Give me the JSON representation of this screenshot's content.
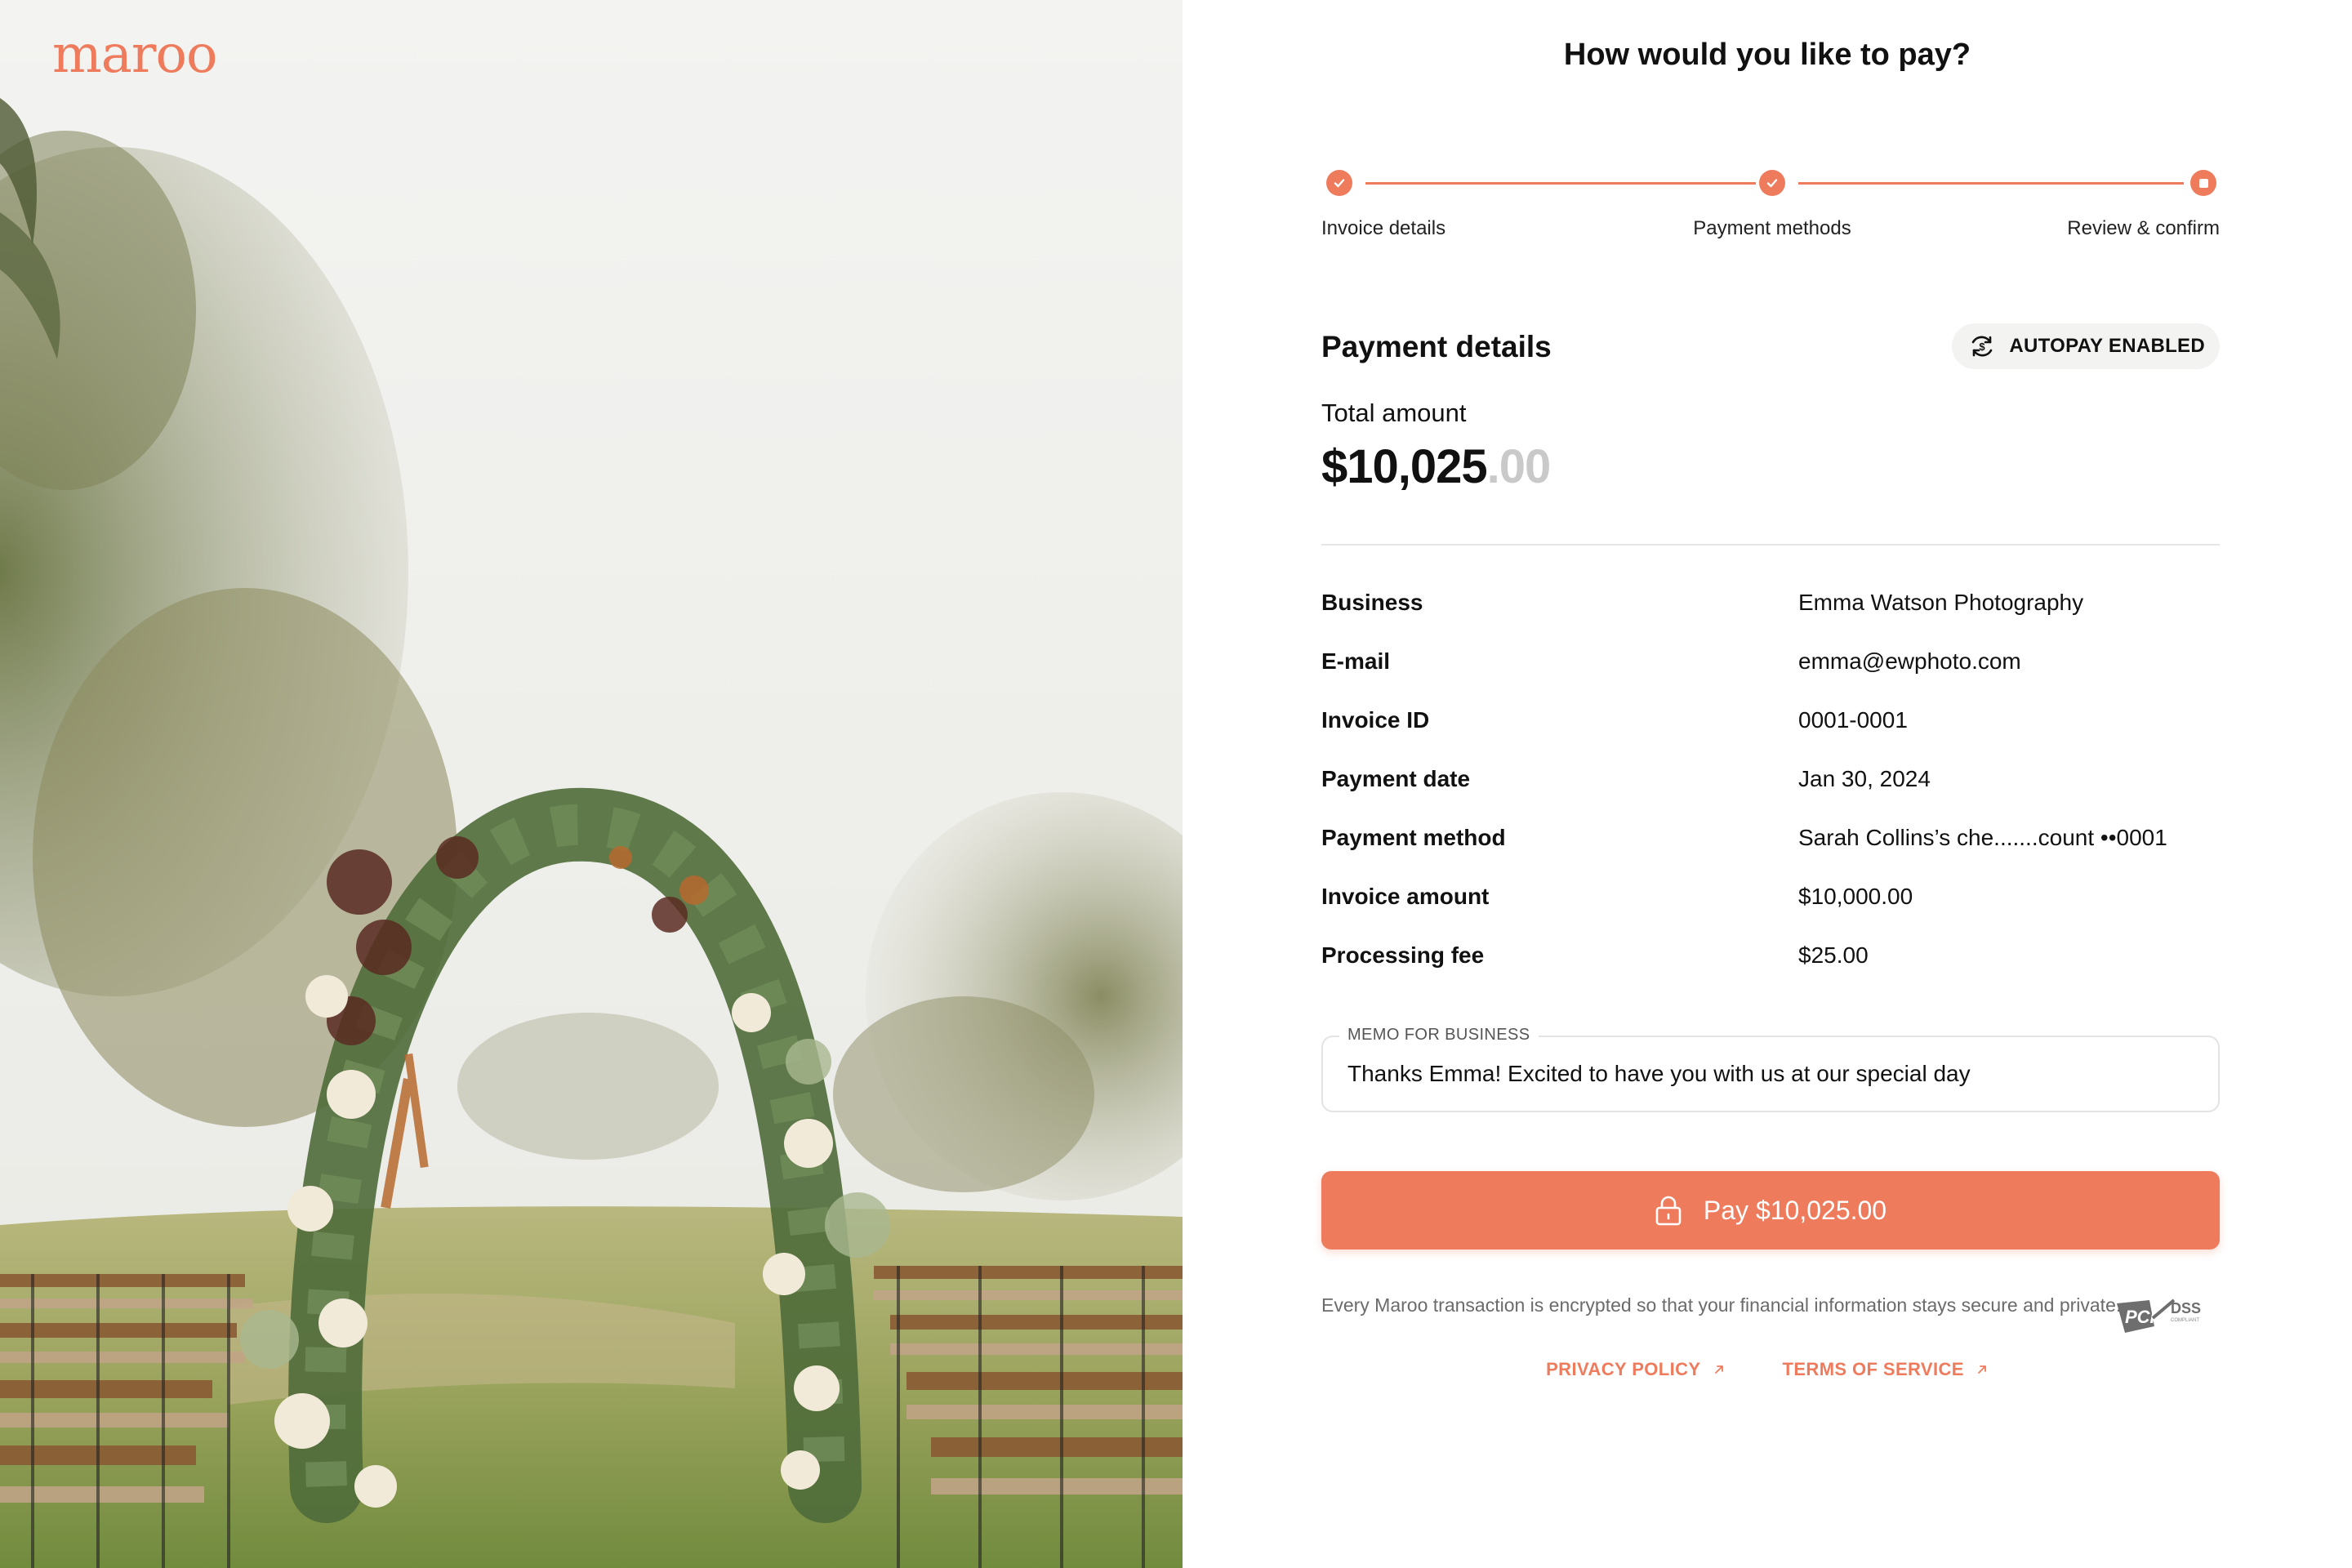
{
  "brand": {
    "logo_text": "maroo",
    "accent_color": "#ef7b5d"
  },
  "page": {
    "title": "How would you like to pay?"
  },
  "stepper": {
    "steps": [
      {
        "label": "Invoice details",
        "state": "complete"
      },
      {
        "label": "Payment methods",
        "state": "complete"
      },
      {
        "label": "Review & confirm",
        "state": "current"
      }
    ]
  },
  "payment_details": {
    "title": "Payment details",
    "autopay_badge": "AUTOPAY ENABLED",
    "autopay_icon": "autopay-cycle-icon",
    "total_label": "Total amount",
    "total_whole": "$10,025",
    "total_cents": ".00"
  },
  "details": [
    {
      "key": "Business",
      "value": "Emma Watson Photography"
    },
    {
      "key": "E-mail",
      "value": "emma@ewphoto.com"
    },
    {
      "key": "Invoice ID",
      "value": "0001-0001"
    },
    {
      "key": "Payment date",
      "value": "Jan 30, 2024"
    },
    {
      "key": "Payment method",
      "value": "Sarah Collins’s che.......count ••0001"
    },
    {
      "key": "Invoice amount",
      "value": "$10,000.00"
    },
    {
      "key": "Processing fee",
      "value": "$25.00"
    }
  ],
  "memo": {
    "label": "MEMO FOR BUSINESS",
    "value": "Thanks Emma! Excited to have you with us at our special day"
  },
  "pay_button": {
    "label": "Pay $10,025.00",
    "icon": "lock-icon"
  },
  "footer": {
    "security_note": "Every Maroo transaction is encrypted so that your financial information stays secure and private.",
    "pci_badge": "PCI DSS",
    "links": [
      {
        "label": "PRIVACY POLICY",
        "icon": "external-link-icon"
      },
      {
        "label": "TERMS OF SERVICE",
        "icon": "external-link-icon"
      }
    ]
  }
}
